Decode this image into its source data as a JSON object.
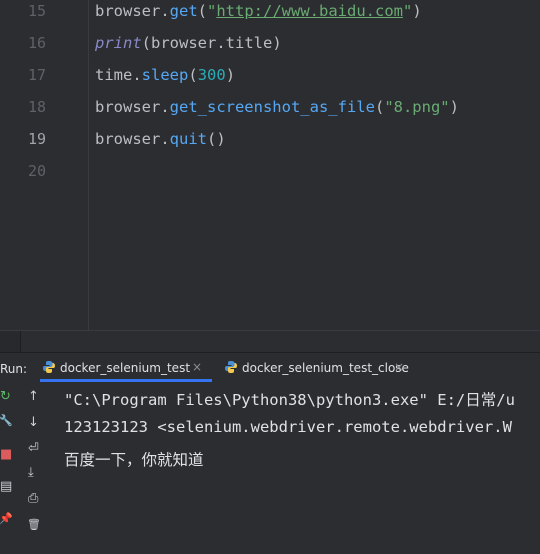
{
  "editor": {
    "line_numbers": [
      "15",
      "16",
      "17",
      "18",
      "19",
      "20"
    ],
    "lines": [
      {
        "segs": [
          {
            "t": "browser.",
            "c": ""
          },
          {
            "t": "get",
            "c": "fn"
          },
          {
            "t": "(",
            "c": ""
          },
          {
            "t": "\"",
            "c": "str"
          },
          {
            "t": "http://www.baidu.com",
            "c": "url"
          },
          {
            "t": "\"",
            "c": "str"
          },
          {
            "t": ")",
            "c": ""
          }
        ]
      },
      {
        "segs": [
          {
            "t": "print",
            "c": "builtin"
          },
          {
            "t": "(browser.title)",
            "c": ""
          }
        ]
      },
      {
        "segs": [
          {
            "t": "time.",
            "c": ""
          },
          {
            "t": "sleep",
            "c": "fn"
          },
          {
            "t": "(",
            "c": ""
          },
          {
            "t": "300",
            "c": "num"
          },
          {
            "t": ")",
            "c": ""
          }
        ]
      },
      {
        "segs": [
          {
            "t": "browser.",
            "c": ""
          },
          {
            "t": "get_screenshot_as_file",
            "c": "fn"
          },
          {
            "t": "(",
            "c": ""
          },
          {
            "t": "\"8.png\"",
            "c": "str"
          },
          {
            "t": ")",
            "c": ""
          }
        ]
      },
      {
        "segs": [
          {
            "t": "browser.",
            "c": ""
          },
          {
            "t": "quit",
            "c": "fn"
          },
          {
            "t": "()",
            "c": ""
          }
        ]
      },
      {
        "segs": []
      }
    ]
  },
  "run": {
    "label": "Run:",
    "tabs": [
      {
        "label": "docker_selenium_test",
        "close": "×",
        "active": true
      },
      {
        "label": "docker_selenium_test_close",
        "close": "×",
        "active": false
      }
    ]
  },
  "console": {
    "lines": [
      "\"C:\\Program Files\\Python38\\python3.exe\" E:/日常/u",
      "123123123 <selenium.webdriver.remote.webdriver.W",
      "百度一下，你就知道"
    ]
  },
  "icons": {
    "rerun": "↻",
    "wrench": "🔧",
    "stop": "■",
    "layout": "▤",
    "pin": "📌",
    "up": "↑",
    "down": "↓",
    "wrap": "⏎",
    "scroll_end": "⤓",
    "print": "⎙",
    "trash": "🗑"
  },
  "colors": {
    "accent": "#3574f0",
    "bg": "#2b2d30",
    "string": "#6aab73",
    "function": "#56a8f5",
    "number": "#2aacb8"
  }
}
